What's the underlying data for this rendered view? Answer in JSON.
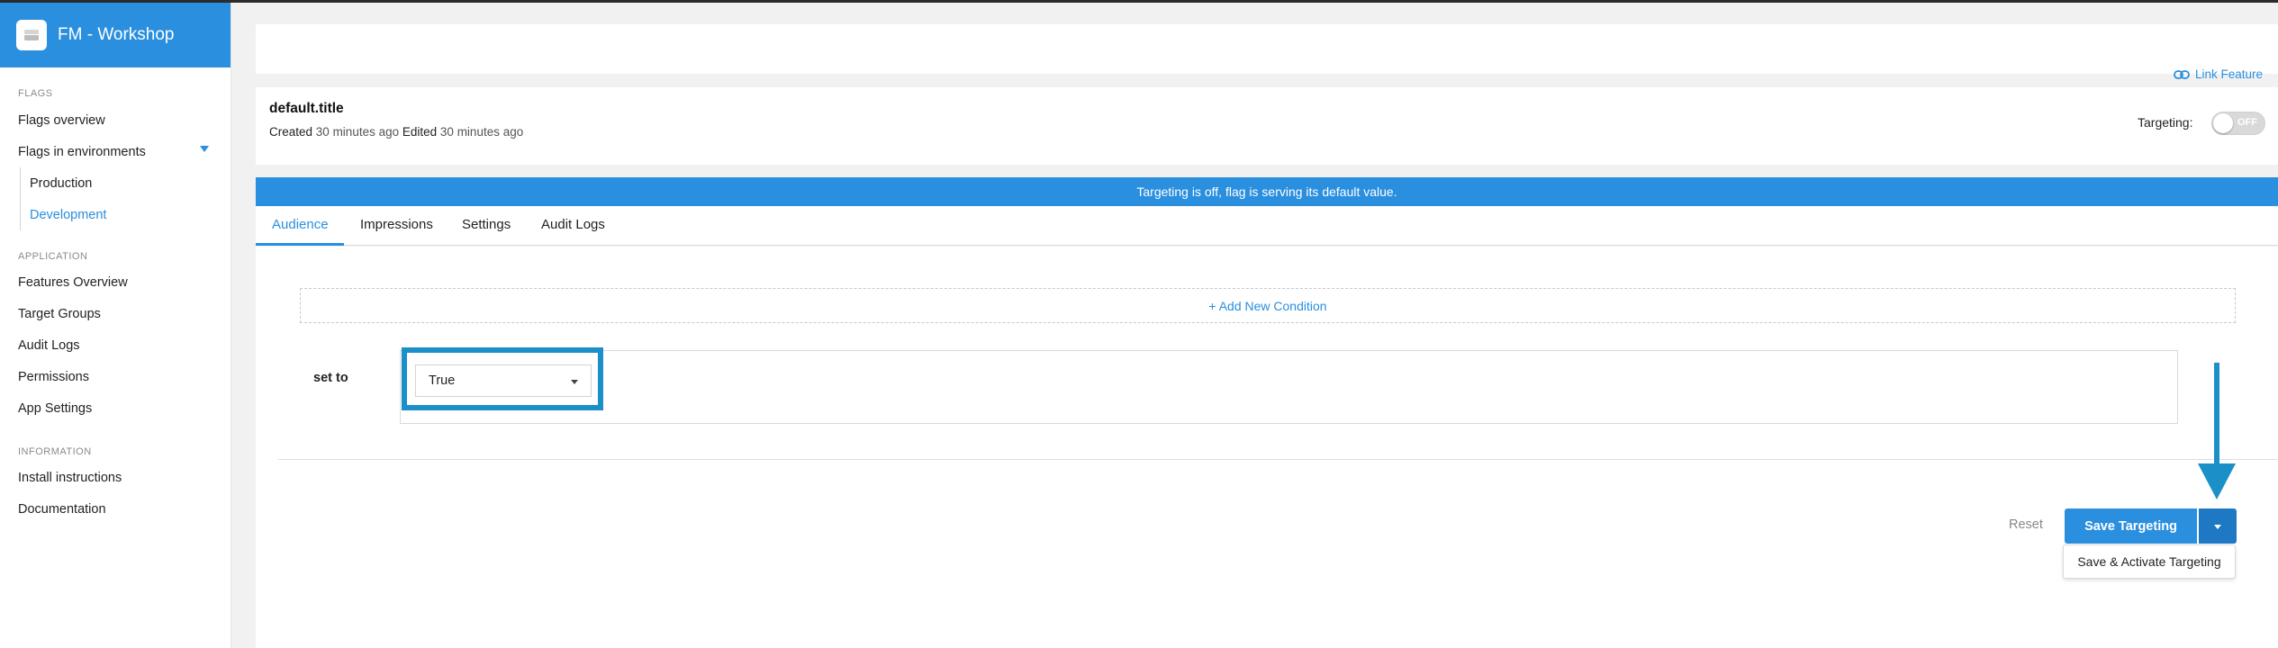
{
  "app": {
    "title": "FM - Workshop"
  },
  "sidebar": {
    "sections": {
      "flags": "FLAGS",
      "application": "APPLICATION",
      "information": "INFORMATION"
    },
    "items": {
      "flags_overview": "Flags overview",
      "flags_in_environments": "Flags in environments",
      "production": "Production",
      "development": "Development",
      "features_overview": "Features Overview",
      "target_groups": "Target Groups",
      "audit_logs": "Audit Logs",
      "permissions": "Permissions",
      "app_settings": "App Settings",
      "install_instructions": "Install instructions",
      "documentation": "Documentation"
    }
  },
  "header": {
    "link_feature": "Link Feature"
  },
  "flag": {
    "title": "default.title",
    "created_label": "Created",
    "created_value": "30 minutes ago",
    "edited_label": "Edited",
    "edited_value": "30 minutes ago",
    "targeting_label": "Targeting:",
    "toggle_state": "OFF"
  },
  "banner": {
    "text": "Targeting is off, flag is serving its default value."
  },
  "tabs": [
    "Audience",
    "Impressions",
    "Settings",
    "Audit Logs"
  ],
  "audience": {
    "add_condition": "+ Add New Condition",
    "set_to_label": "set to",
    "selected_value": "True"
  },
  "actions": {
    "reset": "Reset",
    "save": "Save Targeting",
    "menu_item": "Save & Activate Targeting"
  },
  "colors": {
    "accent": "#2a8fde",
    "annotation": "#1a8fc8"
  }
}
